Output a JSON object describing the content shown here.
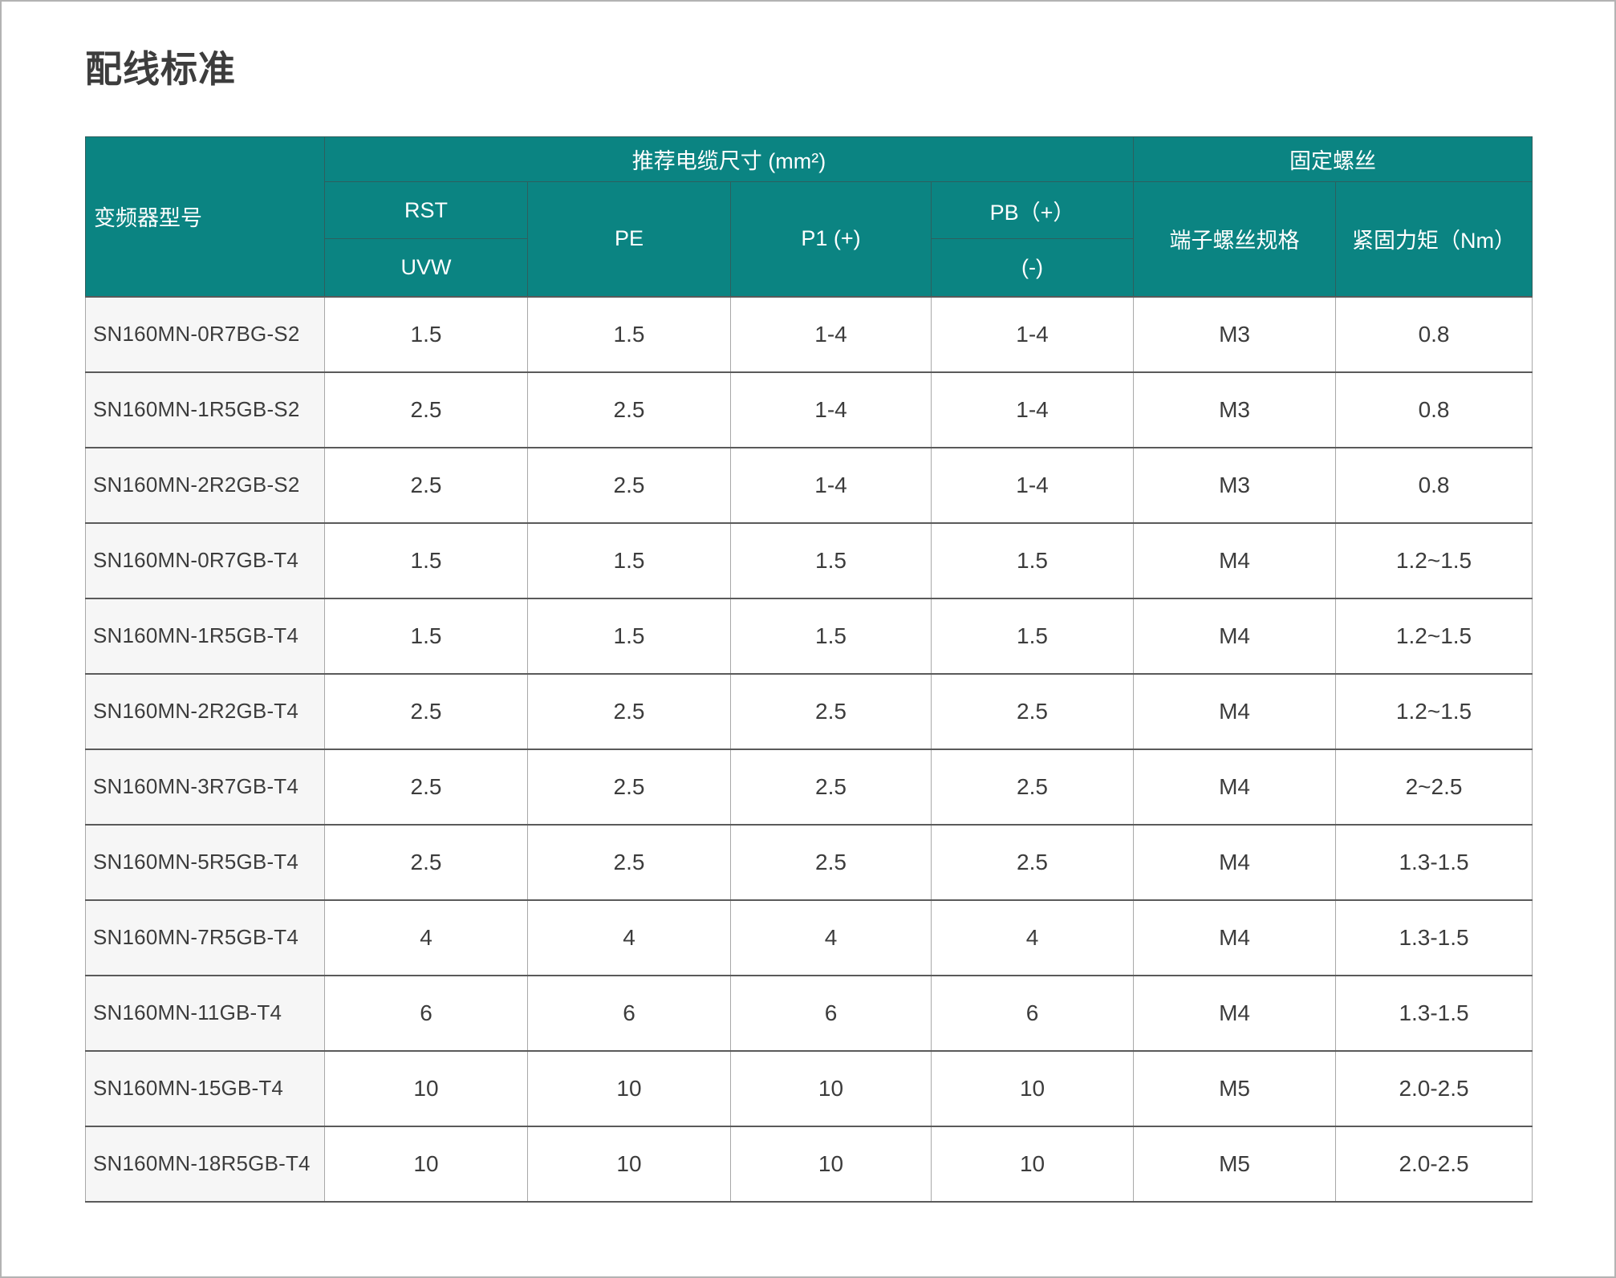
{
  "page": {
    "title": "配线标准"
  },
  "table": {
    "headers": {
      "model": "变频器型号",
      "cable_group": "推荐电缆尺寸 (mm²)",
      "screw_group": "固定螺丝",
      "rst": "RST",
      "uvw": "UVW",
      "pe": "PE",
      "p1": "P1 (+)",
      "pb_plus": "PB（+）",
      "pb_minus": "(-)",
      "screw_spec": "端子螺丝规格",
      "torque": "紧固力矩（Nm）"
    },
    "rows": [
      {
        "model": "SN160MN-0R7BG-S2",
        "rst_uvw": "1.5",
        "pe": "1.5",
        "p1": "1-4",
        "pb": "1-4",
        "screw": "M3",
        "torque": "0.8"
      },
      {
        "model": "SN160MN-1R5GB-S2",
        "rst_uvw": "2.5",
        "pe": "2.5",
        "p1": "1-4",
        "pb": "1-4",
        "screw": "M3",
        "torque": "0.8"
      },
      {
        "model": "SN160MN-2R2GB-S2",
        "rst_uvw": "2.5",
        "pe": "2.5",
        "p1": "1-4",
        "pb": "1-4",
        "screw": "M3",
        "torque": "0.8"
      },
      {
        "model": "SN160MN-0R7GB-T4",
        "rst_uvw": "1.5",
        "pe": "1.5",
        "p1": "1.5",
        "pb": "1.5",
        "screw": "M4",
        "torque": "1.2~1.5"
      },
      {
        "model": "SN160MN-1R5GB-T4",
        "rst_uvw": "1.5",
        "pe": "1.5",
        "p1": "1.5",
        "pb": "1.5",
        "screw": "M4",
        "torque": "1.2~1.5"
      },
      {
        "model": "SN160MN-2R2GB-T4",
        "rst_uvw": "2.5",
        "pe": "2.5",
        "p1": "2.5",
        "pb": "2.5",
        "screw": "M4",
        "torque": "1.2~1.5"
      },
      {
        "model": "SN160MN-3R7GB-T4",
        "rst_uvw": "2.5",
        "pe": "2.5",
        "p1": "2.5",
        "pb": "2.5",
        "screw": "M4",
        "torque": "2~2.5"
      },
      {
        "model": "SN160MN-5R5GB-T4",
        "rst_uvw": "2.5",
        "pe": "2.5",
        "p1": "2.5",
        "pb": "2.5",
        "screw": "M4",
        "torque": "1.3-1.5"
      },
      {
        "model": "SN160MN-7R5GB-T4",
        "rst_uvw": "4",
        "pe": "4",
        "p1": "4",
        "pb": "4",
        "screw": "M4",
        "torque": "1.3-1.5"
      },
      {
        "model": "SN160MN-11GB-T4",
        "rst_uvw": "6",
        "pe": "6",
        "p1": "6",
        "pb": "6",
        "screw": "M4",
        "torque": "1.3-1.5"
      },
      {
        "model": "SN160MN-15GB-T4",
        "rst_uvw": "10",
        "pe": "10",
        "p1": "10",
        "pb": "10",
        "screw": "M5",
        "torque": "2.0-2.5"
      },
      {
        "model": "SN160MN-18R5GB-T4",
        "rst_uvw": "10",
        "pe": "10",
        "p1": "10",
        "pb": "10",
        "screw": "M5",
        "torque": "2.0-2.5"
      }
    ]
  },
  "colors": {
    "header_bg": "#0b8482",
    "header_text": "#ffffff",
    "model_column_bg": "#f6f6f6",
    "row_border": "#5a5a5a",
    "page_frame": "#b3b3b3"
  }
}
